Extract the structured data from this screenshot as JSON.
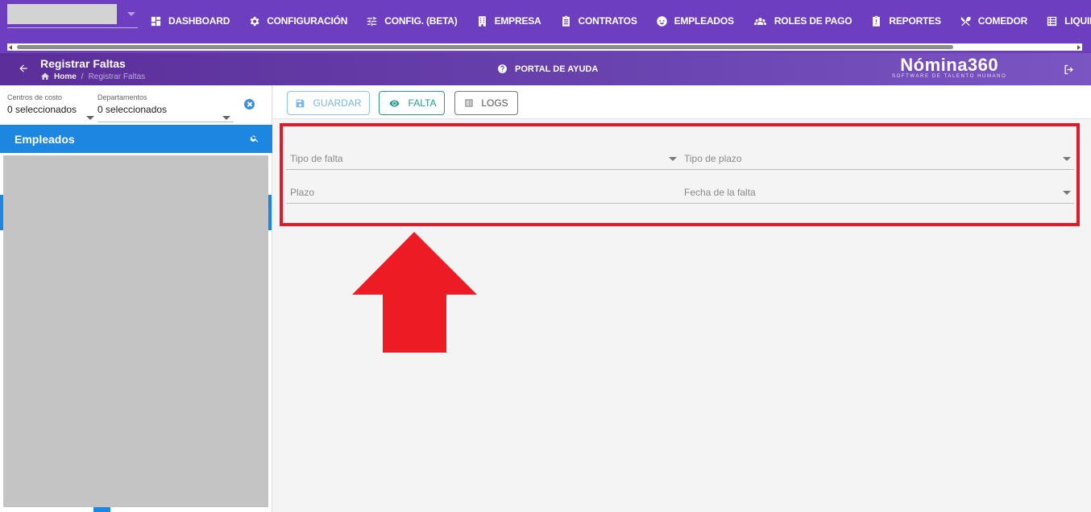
{
  "menu": [
    {
      "label": "DASHBOARD",
      "icon": "dashboard-icon"
    },
    {
      "label": "CONFIGURACIÓN",
      "icon": "gear-icon"
    },
    {
      "label": "CONFIG. (BETA)",
      "icon": "sliders-icon"
    },
    {
      "label": "EMPRESA",
      "icon": "building-icon"
    },
    {
      "label": "CONTRATOS",
      "icon": "clipboard-icon"
    },
    {
      "label": "EMPLEADOS",
      "icon": "face-icon"
    },
    {
      "label": "ROLES DE PAGO",
      "icon": "people-icon"
    },
    {
      "label": "REPORTES",
      "icon": "report-icon"
    },
    {
      "label": "COMEDOR",
      "icon": "cutlery-icon"
    },
    {
      "label": "LIQUIDACIONES",
      "icon": "list-icon"
    }
  ],
  "header": {
    "title": "Registrar Faltas",
    "breadcrumb_home": "Home",
    "breadcrumb_sep": "/",
    "breadcrumb_current": "Registrar Faltas",
    "help": "PORTAL DE AYUDA",
    "brand_name": "Nómina360",
    "brand_tagline": "SOFTWARE DE TALENTO HUMANO"
  },
  "filters": {
    "cost_centers_label": "Centros de costo",
    "cost_centers_value": "0 seleccionados",
    "departments_label": "Departamentos",
    "departments_value": "0 seleccionados"
  },
  "employees": {
    "title": "Empleados"
  },
  "toolbar": {
    "guardar": "GUARDAR",
    "falta": "FALTA",
    "logs": "LOGS"
  },
  "form": {
    "tipo_falta": "Tipo de falta",
    "tipo_plazo": "Tipo de plazo",
    "plazo": "Plazo",
    "fecha_falta": "Fecha de la falta"
  },
  "colors": {
    "nav": "#6d3fc0",
    "accent_blue": "#1d86e0",
    "highlight_red": "#e3192a",
    "falta_teal": "#2a9a8a"
  }
}
